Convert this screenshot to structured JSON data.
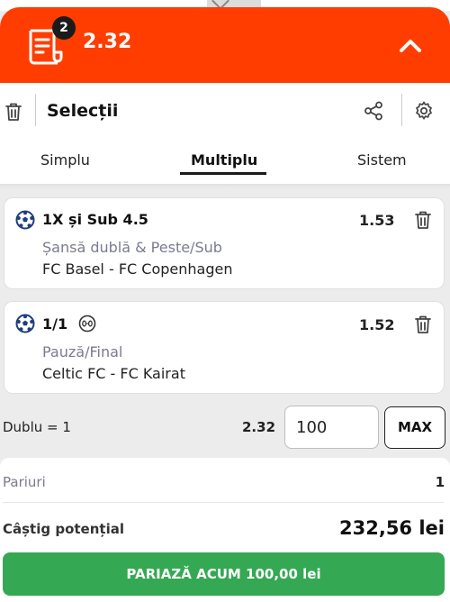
{
  "header": {
    "selections_count": "2",
    "total_odds": "2.32"
  },
  "panel": {
    "title": "Selecții"
  },
  "tabs": [
    {
      "label": "Simplu",
      "active": false
    },
    {
      "label": "Multiplu",
      "active": true
    },
    {
      "label": "Sistem",
      "active": false
    }
  ],
  "selections": [
    {
      "pick": "1X și Sub 4.5",
      "odds": "1.53",
      "market": "Șansă dublă & Peste/Sub",
      "match": "FC Basel - FC Copenhagen",
      "score_badge": false
    },
    {
      "pick": "1/1",
      "odds": "1.52",
      "market": "Pauză/Final",
      "match": "Celtic FC - FC Kairat",
      "score_badge": true
    }
  ],
  "stake": {
    "label": "Dublu = 1",
    "odds": "2.32",
    "value": "100",
    "max_label": "MAX"
  },
  "summary": {
    "bets_label": "Pariuri",
    "bets_value": "1",
    "win_label": "Câștig potențial",
    "win_value": "232,56 lei"
  },
  "place_bet": {
    "label": "PARIAZĂ ACUM 100,00 lei"
  },
  "colors": {
    "brand": "#ff3d00",
    "cta": "#35a853",
    "muted": "#7a7b8f"
  },
  "icons": [
    "bet-slip-icon",
    "chevron-up-icon",
    "trash-icon",
    "share-icon",
    "gear-icon",
    "football-icon",
    "score-icon"
  ]
}
